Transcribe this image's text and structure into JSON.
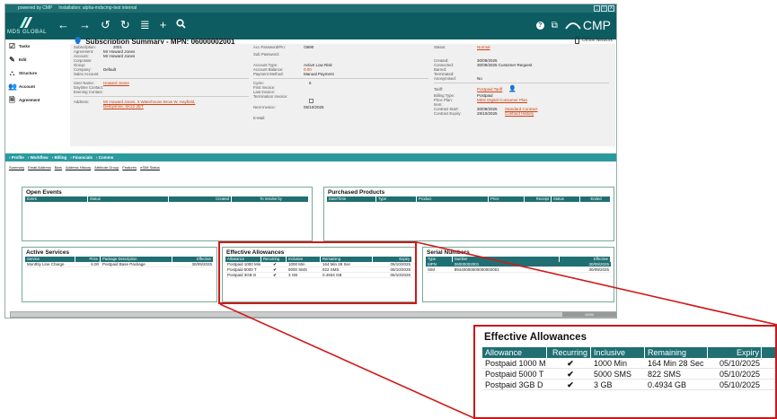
{
  "app": {
    "brand_line": "powered by CMP",
    "installation": "Installation: alpha-mdscmp-test internal",
    "logo_text": "MDS GLOBAL",
    "brand": "CMP",
    "window_buttons": [
      "_",
      "□",
      "X"
    ],
    "nav_icons": [
      "←",
      "→",
      "↺",
      "↻",
      "≣",
      "+",
      "🔍"
    ]
  },
  "header": {
    "title": "Subscription Summary - MPN: 06000002001",
    "offline": "Offline Network"
  },
  "sidebar": {
    "items": [
      {
        "label": "Tasks",
        "icon": "tasks-icon"
      },
      {
        "label": "Edit",
        "icon": "edit-icon"
      },
      {
        "label": "Structure",
        "icon": "structure-icon"
      },
      {
        "label": "Account",
        "icon": "account-icon"
      },
      {
        "label": "Agreement",
        "icon": "agreement-icon"
      }
    ]
  },
  "details": {
    "col1": [
      {
        "label": "Subscription:",
        "value": "2001"
      },
      {
        "label": "Agreement:",
        "value": "Mr Howard Jones"
      },
      {
        "label": "Account:",
        "value": "Mr Howard Jones"
      },
      {
        "label": "Corporate:",
        "value": ""
      },
      {
        "label": "Group:",
        "value": ""
      },
      {
        "label": "Company:",
        "value": "Default"
      },
      {
        "label": "Sales Account:",
        "value": ""
      }
    ],
    "user": [
      {
        "label": "User Name:",
        "value": "Howard Jones"
      },
      {
        "label": "Daytime Contact:",
        "value": ""
      },
      {
        "label": "Evening Contact:",
        "value": ""
      }
    ],
    "address_label": "Address:",
    "address_line1": "Mr Howard Jones, 3 Waterhouse Brow W, Hayfield,",
    "address_line2": "Derbyshire, SK22 2ET",
    "col2": [
      {
        "label": "Acc Password/Pin:",
        "value": "/3690"
      },
      {
        "label": "Sub Password:",
        "value": ""
      },
      {
        "label": "Account Type:",
        "value": "Active Low Risk"
      },
      {
        "label": "Account Balance:",
        "value": "0.00"
      },
      {
        "label": "Payment Method:",
        "value": "Manual Payment"
      }
    ],
    "col2b": [
      {
        "label": "Cycle:",
        "value": "6"
      },
      {
        "label": "First Invoice:",
        "value": ""
      },
      {
        "label": "Last Invoice:",
        "value": ""
      },
      {
        "label": "Termination Invoice:",
        "value": ""
      },
      {
        "label": "Next Invoice:",
        "value": "05/10/2025"
      },
      {
        "label": "E-Mail:",
        "value": ""
      }
    ],
    "col3": [
      {
        "label": "Status:",
        "value": "Normal"
      },
      {
        "label": "Created:",
        "value": "30/09/2025"
      },
      {
        "label": "Connected:",
        "value": "30/09/2025 Customer Request"
      },
      {
        "label": "Barred:",
        "value": ""
      },
      {
        "label": "Terminated:",
        "value": ""
      },
      {
        "label": "Anonymised:",
        "value": "No"
      }
    ],
    "col3b": [
      {
        "label": "Tariff:",
        "value": "Postpaid Tariff"
      },
      {
        "label": "Billing Type:",
        "value": "Postpaid"
      },
      {
        "label": "Price Plan:",
        "value": "MDS Digital Consumer Plan"
      },
      {
        "label": "Item:",
        "value": ""
      },
      {
        "label": "Contract Start:",
        "value": "30/09/2025",
        "link": "Standard Contract"
      },
      {
        "label": "Contract Expiry:",
        "value": "29/10/2025",
        "link": "Contract History"
      }
    ]
  },
  "tabs": [
    "Profile",
    "Workflow",
    "Billing",
    "Financials",
    "Comms"
  ],
  "subtabs": [
    "Summary",
    "Email Address",
    "Bars",
    "Address History",
    "Attribute Group",
    "Features",
    "eSIM Status"
  ],
  "open_events": {
    "title": "Open Events",
    "columns": [
      "Event",
      "Status",
      "Created",
      "To resolve by"
    ]
  },
  "purchased_products": {
    "title": "Purchased Products",
    "columns": [
      "Date/Time",
      "Type",
      "Product",
      "Price",
      "Receipt",
      "Status",
      "Ended"
    ]
  },
  "active_services": {
    "title": "Active Services",
    "columns": [
      "Service",
      "Price",
      "Package Description",
      "Effective"
    ],
    "rows": [
      [
        "Monthly Line Charge",
        "6.00",
        "Postpaid Base Package",
        "30/09/2025"
      ]
    ]
  },
  "effective_allowances": {
    "title": "Effective Allowances",
    "columns": [
      "Allowance",
      "Recurring",
      "Inclusive",
      "Remaining",
      "Expiry"
    ],
    "rows": [
      [
        "Postpaid 1000 Min",
        "✔",
        "1000 Min",
        "164 Min 28 Sec",
        "05/10/2025"
      ],
      [
        "Postpaid 5000 T",
        "✔",
        "5000 SMS",
        "822 SMS",
        "05/10/2025"
      ],
      [
        "Postpaid 3GB D",
        "✔",
        "3 GB",
        "0.4934 GB",
        "05/10/2025"
      ]
    ]
  },
  "zoom": {
    "title": "Effective Allowances",
    "columns": [
      "Allowance",
      "Recurring",
      "Inclusive",
      "Remaining",
      "Expiry"
    ],
    "rows": [
      [
        "Postpaid 1000 M",
        "✔",
        "1000 Min",
        "164 Min 28 Sec",
        "05/10/2025"
      ],
      [
        "Postpaid 5000 T",
        "✔",
        "5000 SMS",
        "822 SMS",
        "05/10/2025"
      ],
      [
        "Postpaid 3GB D",
        "✔",
        "3 GB",
        "0.4934 GB",
        "05/10/2025"
      ]
    ]
  },
  "serial_numbers": {
    "title": "Serial Numbers",
    "columns": [
      "Type",
      "Number",
      "Effective"
    ],
    "rows": [
      [
        "MPN",
        "06000002001",
        "30/09/2025"
      ],
      [
        "SIM",
        "89440000000000002001",
        "30/09/2025"
      ]
    ]
  },
  "status": {
    "progress": "100%"
  }
}
